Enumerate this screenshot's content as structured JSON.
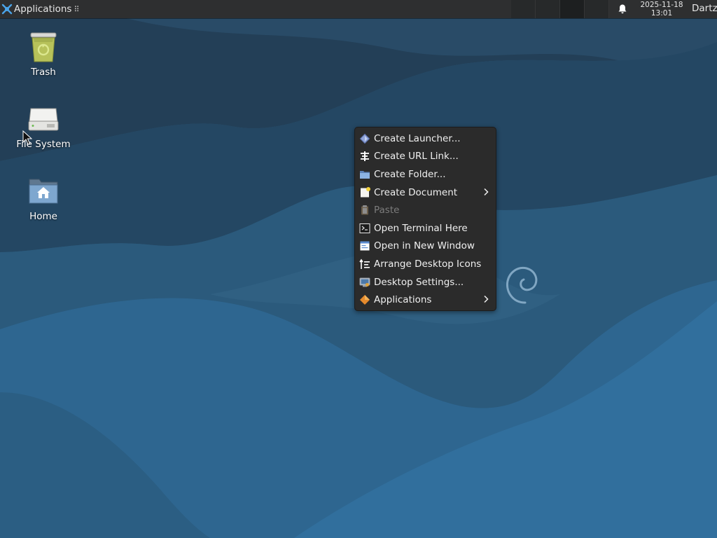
{
  "panel": {
    "applications_label": "Applications",
    "handle_glyph": "⠿",
    "clock_date": "2025-11-18",
    "clock_time": "13:01",
    "user_label": "Dartz",
    "icons": {
      "menu_logo": "xfce-logo-icon",
      "notifications": "bell-icon"
    }
  },
  "desktop": {
    "icons": [
      {
        "label": "Trash",
        "icon": "trash-icon"
      },
      {
        "label": "File System",
        "icon": "drive-icon"
      },
      {
        "label": "Home",
        "icon": "home-folder-icon"
      }
    ],
    "background_colors": {
      "light": "#2f6a93",
      "mid": "#28567a",
      "dark": "#1f3d57"
    }
  },
  "context_menu": {
    "items": [
      {
        "label": "Create Launcher...",
        "icon": "launcher-icon",
        "enabled": true,
        "submenu": false
      },
      {
        "label": "Create URL Link...",
        "icon": "url-link-icon",
        "enabled": true,
        "submenu": false
      },
      {
        "label": "Create Folder...",
        "icon": "folder-icon",
        "enabled": true,
        "submenu": false
      },
      {
        "label": "Create Document",
        "icon": "document-icon",
        "enabled": true,
        "submenu": true
      },
      {
        "label": "Paste",
        "icon": "paste-icon",
        "enabled": false,
        "submenu": false
      },
      {
        "label": "Open Terminal Here",
        "icon": "terminal-icon",
        "enabled": true,
        "submenu": false
      },
      {
        "label": "Open in New Window",
        "icon": "new-window-icon",
        "enabled": true,
        "submenu": false
      },
      {
        "label": "Arrange Desktop Icons",
        "icon": "arrange-icon",
        "enabled": true,
        "submenu": false
      },
      {
        "label": "Desktop Settings...",
        "icon": "settings-icon",
        "enabled": true,
        "submenu": false
      },
      {
        "label": "Applications",
        "icon": "applications-icon",
        "enabled": true,
        "submenu": true
      }
    ]
  }
}
